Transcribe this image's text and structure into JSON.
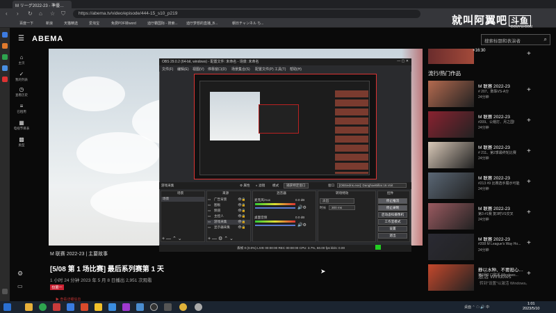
{
  "browser": {
    "tab_title": "M リーグ2022-23 - 準優…",
    "url": "https://abema.tv/video/episode/444-15_s10_p219",
    "bookmarks": [
      "百度一下",
      "新浪",
      "天猫精选",
      "爱淘宝",
      "免费PDF转word",
      "迪厅霸国际 - 搜索...",
      "迪厅梦想的直播_B...",
      "朝日チャンネル ち..."
    ]
  },
  "abema": {
    "logo": "ABEMA",
    "search_placeholder": "搜索标题和表演者",
    "nav": [
      {
        "icon": "home-icon",
        "label": "主页"
      },
      {
        "icon": "check-icon",
        "label": "我的列表"
      },
      {
        "icon": "history-icon",
        "label": "查看历史"
      },
      {
        "icon": "list-icon",
        "label": "已租用"
      },
      {
        "icon": "calendar-icon",
        "label": "电视节目表"
      },
      {
        "icon": "grid-icon",
        "label": "类型"
      }
    ],
    "video": {
      "series": "M 联赛 2022-23 | 主要故事",
      "title": "[5/08 第 1 场比赛] 最后系列赛第 1 天",
      "info": "1 小时 24 分钟    2023 年 5 月 8 日播出    2,951 次观看",
      "badge": "仅限一",
      "more": "▶ 查看详细信息"
    },
    "top_thumb_label": "×16:30",
    "list_title": "流行/热门作品",
    "list": [
      {
        "title": "M 联赛 2022-23",
        "sub": "# 207、数珠VS-A分",
        "dur": "24分钟",
        "color": "#b46a4f"
      },
      {
        "title": "M 联赛 2022-23",
        "sub": "#209、公帽打、月之国!",
        "dur": "24分钟",
        "color": "#8a2230"
      },
      {
        "title": "M 联赛 2022-23",
        "sub": "# 211、第2季最终轮比赛",
        "dur": "24分钟",
        "color": "#d9c9b8"
      },
      {
        "title": "M 联赛 2022-23",
        "sub": "#213 #9 比赛选手展示可能",
        "dur": "24分钟",
        "color": "#5a6775"
      },
      {
        "title": "M 联赛 2022-23",
        "sub": "第3 #1赛 复3时VS交叉",
        "dur": "24分钟",
        "color": "#9a5a60"
      },
      {
        "title": "M 联赛 2022-23",
        "sub": "#208 M League's Way Ho...",
        "dur": "24分钟",
        "color": "#2a2a33"
      },
      {
        "title": "静以水种、不要担心…",
        "sub": "第2月2 口联系 Windows...",
        "dur": "",
        "color": "#c4482c"
      }
    ]
  },
  "obs": {
    "title": "OBS 29.0.2 (64-bit, windows) - 配置文件: 未命名 - 场景: 未命名",
    "menu": [
      "文件(F)",
      "编辑(E)",
      "视图(V)",
      "停靠窗口(D)",
      "场景集合(S)",
      "配置文件(P)",
      "工具(T)",
      "帮助(H)"
    ],
    "toolbar": [
      "游戏采集",
      "属性",
      "滤镜",
      "模式",
      "捕获特定窗口",
      "窗口",
      "[OBSedns.exe]: DanghaeBillar.16.Voit"
    ],
    "panels": [
      "场景",
      "来源",
      "混音器",
      "转场特效",
      "控件"
    ],
    "scene": "场景",
    "sources": [
      "广告背景",
      "图板",
      "频道",
      "主控人",
      "游戏采集",
      "显示器采集"
    ],
    "mixer": [
      "麦克风/Aux",
      "桌面音频"
    ],
    "mixer_db": [
      "0.0 dB",
      "0.0 dB"
    ],
    "transition": {
      "type": "淡出",
      "duration_label": "时长",
      "duration": "300 ms"
    },
    "controls": [
      "停止推流",
      "停止录制",
      "启动虚拟摄像机",
      "工作室模式",
      "设置",
      "退出"
    ],
    "status": "丢帧 0 (0.0%)    LIVE  00:00:00    REC  00:00:00    CPU: 3.7%, 60.00 fps    kb/s: 0.00"
  },
  "watermark": {
    "main": "就叫阿翼吧",
    "brand": "斗鱼",
    "sub": "DOUYU.COM"
  },
  "windows_activation": {
    "line1": "激活 Windows",
    "line2": "转到\"设置\"以激活 Windows。"
  },
  "taskbar": {
    "clock_time": "1:01",
    "clock_date": "2023/5/10",
    "tray_label": "桌面",
    "ime": "中"
  }
}
